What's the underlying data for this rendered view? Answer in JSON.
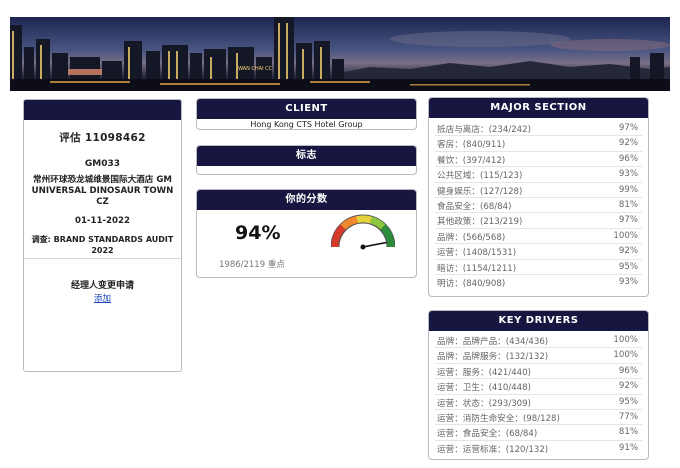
{
  "banner": {
    "sign_text": "WAN CHAI CC"
  },
  "left_card": {
    "score_label": "评估 11098462",
    "hotel_code": "GM033",
    "hotel_name": "常州环球恐龙城维景国际大酒店 GM UNIVERSAL DINOSAUR TOWN CZ",
    "date": "01-11-2022",
    "audit": "调查: BRAND STANDARDS AUDIT 2022",
    "manager_change": "经理人变更申请",
    "add_link": "添加"
  },
  "client": {
    "title": "CLIENT",
    "name": "Hong Kong CTS Hotel Group"
  },
  "logo": {
    "title": "标志"
  },
  "score": {
    "title": "你的分数",
    "percent": "94%",
    "points": "1986/2119 重点",
    "gauge_value": 0.94
  },
  "major_section": {
    "title": "MAJOR SECTION",
    "rows": [
      {
        "label": "抵店与离店：(234/242)",
        "pct": "97%"
      },
      {
        "label": "客房：(840/911)",
        "pct": "92%"
      },
      {
        "label": "餐饮：(397/412)",
        "pct": "96%"
      },
      {
        "label": "公共区域：(115/123)",
        "pct": "93%"
      },
      {
        "label": "健身娱乐：(127/128)",
        "pct": "99%"
      },
      {
        "label": "食品安全：(68/84)",
        "pct": "81%"
      },
      {
        "label": "其他政策：(213/219)",
        "pct": "97%"
      },
      {
        "label": "品牌：(566/568)",
        "pct": "100%"
      },
      {
        "label": "运营：(1408/1531)",
        "pct": "92%"
      },
      {
        "label": "暗访：(1154/1211)",
        "pct": "95%"
      },
      {
        "label": "明访：(840/908)",
        "pct": "93%"
      }
    ]
  },
  "key_drivers": {
    "title": "KEY DRIVERS",
    "rows": [
      {
        "label": "品牌：品牌产品：(434/436)",
        "pct": "100%"
      },
      {
        "label": "品牌：品牌服务：(132/132)",
        "pct": "100%"
      },
      {
        "label": "运营：服务：(421/440)",
        "pct": "96%"
      },
      {
        "label": "运营：卫生：(410/448)",
        "pct": "92%"
      },
      {
        "label": "运营：状态：(293/309)",
        "pct": "95%"
      },
      {
        "label": "运营：消防生命安全：(98/128)",
        "pct": "77%"
      },
      {
        "label": "运营：食品安全：(68/84)",
        "pct": "81%"
      },
      {
        "label": "运营：运营标准：(120/132)",
        "pct": "91%"
      }
    ]
  }
}
